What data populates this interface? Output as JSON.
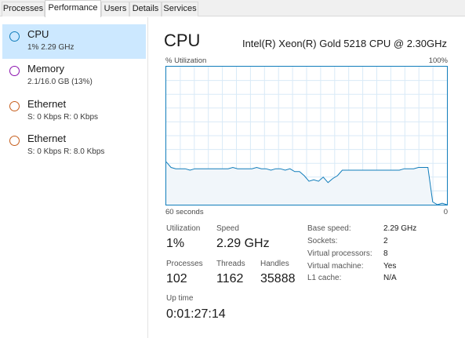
{
  "tabs": [
    {
      "label": "Processes"
    },
    {
      "label": "Performance",
      "active": true
    },
    {
      "label": "Users"
    },
    {
      "label": "Details"
    },
    {
      "label": "Services"
    }
  ],
  "sidebar": {
    "items": [
      {
        "title": "CPU",
        "sub": "1% 2.29 GHz",
        "ring_color": "#117dbb",
        "selected": true
      },
      {
        "title": "Memory",
        "sub": "2.1/16.0 GB (13%)",
        "ring_color": "#8b12ae"
      },
      {
        "title": "Ethernet",
        "sub": "S: 0 Kbps  R: 0 Kbps",
        "ring_color": "#c65e1d"
      },
      {
        "title": "Ethernet",
        "sub": "S: 0 Kbps  R: 8.0 Kbps",
        "ring_color": "#c65e1d"
      }
    ]
  },
  "main": {
    "title": "CPU",
    "processor": "Intel(R) Xeon(R) Gold 5218 CPU @ 2.30GHz",
    "graph": {
      "y_label": "% Utilization",
      "y_max_label": "100%",
      "x_left_label": "60 seconds",
      "x_right_label": "0",
      "line_color": "#117dbb",
      "fill_color": "#f1f6fa",
      "grid_color": "#d9eaf7",
      "series": [
        31,
        27,
        26,
        26,
        26,
        25,
        26,
        26,
        26,
        26,
        26,
        26,
        26,
        26,
        27,
        26,
        26,
        26,
        26,
        27,
        26,
        26,
        25,
        26,
        26,
        25,
        26,
        24,
        24,
        21,
        17,
        18,
        17,
        20,
        16,
        19,
        21,
        25,
        25,
        25,
        25,
        25,
        25,
        25,
        25,
        25,
        25,
        25,
        25,
        25,
        26,
        26,
        26,
        27,
        27,
        27,
        2,
        0,
        1,
        0
      ]
    },
    "stats": {
      "utilization_label": "Utilization",
      "utilization_value": "1%",
      "speed_label": "Speed",
      "speed_value": "2.29 GHz",
      "processes_label": "Processes",
      "processes_value": "102",
      "threads_label": "Threads",
      "threads_value": "1162",
      "handles_label": "Handles",
      "handles_value": "35888",
      "uptime_label": "Up time",
      "uptime_value": "0:01:27:14"
    },
    "details": [
      {
        "key": "Base speed:",
        "value": "2.29 GHz"
      },
      {
        "key": "Sockets:",
        "value": "2"
      },
      {
        "key": "Virtual processors:",
        "value": "8"
      },
      {
        "key": "Virtual machine:",
        "value": "Yes"
      },
      {
        "key": "L1 cache:",
        "value": "N/A"
      }
    ]
  }
}
